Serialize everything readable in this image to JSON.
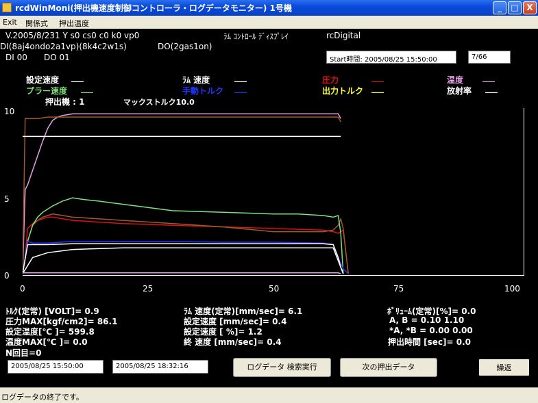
{
  "window": {
    "title": "rcdWinMoni(押出機速度制御コントローラ・ログデータモニター) 1号機",
    "min_label": "_",
    "max_label": "□",
    "close_label": "X"
  },
  "menu": [
    "Exit",
    "関係式",
    "押出温度"
  ],
  "header": {
    "version": "V.2005/8/231 Y s0 cs0 c0 k0 vp0",
    "display_title": "ﾗﾑ ｺﾝﾄﾛｰﾙ ﾃﾞｨｽﾌﾟﾚｲ",
    "brand": "rcDigital",
    "di_line": "DI(8aj4ondo2a1vp)(8k4c2w1s)",
    "do_line": "DO(2gas1on)",
    "di_value": "DI 00",
    "do_value": "DO 01",
    "start_time": "Start時間:    2005/08/25 15:50:00",
    "counter": "7/66"
  },
  "legend": {
    "set_speed": "設定速度",
    "ram_speed": "ﾗﾑ 速度",
    "pressure": "圧力",
    "temperature": "温度",
    "puller_speed": "プラー速度",
    "manual_torque": "手動トルク",
    "output_torque": "出力トルク",
    "radiation": "放射率",
    "extruder": "押出機 : 1",
    "max_torque": "マックストルク10.0",
    "placeholder": "___"
  },
  "colors": {
    "set_speed": "#ffffff",
    "ram_speed": "#ffffff",
    "pressure": "#dd1111",
    "temperature": "#e6a0e6",
    "puller_speed": "#80e080",
    "manual_torque": "#2233ff",
    "output_torque": "#ffff33",
    "radiation": "#ffffff",
    "brown": "#a05a28"
  },
  "chart_data": {
    "type": "line",
    "x_ticks": [
      "0",
      "25",
      "50",
      "75",
      "100"
    ],
    "y_ticks": [
      "0",
      "5",
      "10"
    ],
    "xlim": [
      0,
      100
    ],
    "ylim": [
      0,
      10
    ],
    "grid": false,
    "series": [
      {
        "color": "#e6a0e6",
        "x": [
          0,
          0.5,
          1,
          2,
          3,
          4,
          5,
          6,
          7,
          8,
          10,
          12,
          15,
          20,
          40,
          60,
          63,
          63.5
        ],
        "y": [
          0,
          5.2,
          5.5,
          6.4,
          7.3,
          8.2,
          9.0,
          9.5,
          9.7,
          9.8,
          9.9,
          9.9,
          9.9,
          9.9,
          9.9,
          9.9,
          9.9,
          9.6
        ]
      },
      {
        "color": "#a05a28",
        "x": [
          0,
          0.5,
          1,
          3,
          5,
          10,
          30,
          63,
          63.5
        ],
        "y": [
          0,
          9.6,
          9.6,
          9.6,
          9.7,
          9.7,
          9.7,
          9.7,
          9.4
        ]
      },
      {
        "color": "#ffffff",
        "x": [
          0,
          8,
          63.5
        ],
        "y": [
          8.5,
          8.5,
          8.5
        ]
      },
      {
        "color": "#dd1111",
        "x": [
          0,
          0.5,
          1,
          2,
          3,
          4,
          5,
          6,
          8,
          10,
          15,
          20,
          30,
          40,
          50,
          55,
          60,
          62,
          63,
          64,
          65
        ],
        "y": [
          0,
          1.0,
          2.8,
          3.1,
          3.3,
          3.4,
          3.5,
          3.5,
          3.4,
          3.3,
          3.2,
          3.1,
          3.0,
          2.9,
          2.8,
          2.75,
          2.7,
          2.6,
          2.5,
          2.7,
          0
        ]
      },
      {
        "color": "#a05a28",
        "x": [
          0,
          1,
          2,
          3,
          4,
          5,
          6,
          8,
          10,
          20,
          30,
          40,
          50,
          60,
          62,
          63,
          63.5,
          64,
          65
        ],
        "y": [
          0,
          2.0,
          3.0,
          3.3,
          3.5,
          3.6,
          3.7,
          3.6,
          3.5,
          3.3,
          3.1,
          2.9,
          2.6,
          2.6,
          2.7,
          3.0,
          3.4,
          2.8,
          0
        ]
      },
      {
        "color": "#80e080",
        "x": [
          0,
          1,
          2,
          3,
          4,
          5,
          6,
          8,
          10,
          12,
          15,
          20,
          25,
          30,
          40,
          50,
          55,
          60,
          62,
          63,
          63.5,
          64
        ],
        "y": [
          0,
          2.0,
          3.0,
          3.5,
          3.8,
          4.0,
          4.2,
          4.5,
          4.7,
          4.6,
          4.5,
          4.3,
          4.1,
          3.9,
          3.8,
          3.7,
          3.7,
          3.6,
          3.5,
          3.6,
          2.5,
          0
        ]
      },
      {
        "color": "#2233ff",
        "x": [
          0,
          1,
          2,
          5,
          10,
          20,
          30,
          40,
          50,
          60,
          62,
          63,
          64,
          65
        ],
        "y": [
          0,
          2.0,
          1.9,
          1.9,
          2.0,
          2.0,
          2.0,
          1.95,
          1.95,
          1.9,
          1.8,
          1.0,
          0.3,
          0
        ]
      },
      {
        "color": "#ffffff",
        "x": [
          0,
          1,
          2,
          5,
          10,
          20,
          30,
          40,
          50,
          60,
          62,
          63,
          63.5,
          64
        ],
        "y": [
          0,
          1.8,
          1.8,
          1.8,
          1.85,
          1.85,
          1.85,
          1.85,
          1.85,
          1.85,
          1.8,
          1.0,
          0.4,
          0
        ]
      },
      {
        "color": "#ffffff",
        "x": [
          0,
          1,
          2,
          5,
          10,
          20,
          30,
          40,
          50,
          60,
          62,
          63,
          64
        ],
        "y": [
          0,
          0.5,
          1.0,
          1.3,
          1.5,
          1.6,
          1.6,
          1.6,
          1.6,
          1.6,
          1.6,
          0.8,
          0
        ]
      },
      {
        "color": "#e6a0e6",
        "x": [
          0,
          63,
          63.5
        ],
        "y": [
          0.05,
          0.05,
          0
        ]
      }
    ]
  },
  "stats": {
    "torque": "ﾄﾙｸ(定常)  [VOLT]= 0.9",
    "pressure_max": "圧力MAX[kgf/cm2]= 86.1",
    "set_temp": "設定温度[℃     ]= 599.8",
    "temp_max": "温度MAX[℃     ]= 0.0",
    "n_count": "N回目=0",
    "ram_speed_steady": "ﾗﾑ 速度(定常)[mm/sec]= 6.1",
    "set_speed_1": "設定速度        [mm/sec]= 0.4",
    "set_speed_2": "設定速度              [ %]= 1.2",
    "end_speed": "終  速度        [mm/sec]= 0.4",
    "volume": "ﾎﾞﾘｭｰﾑ(定常)[%]= 0.0",
    "ab": "A, B              = 0.10 1.10",
    "ab_star": "*A, *B            = 0.00 0.00",
    "extrude_time": "押出時間   [sec]= 0.0"
  },
  "controls": {
    "date_from": "2005/08/25 15:50:00",
    "date_to": "2005/08/25 18:32:16",
    "search_button": "ログデータ  検索実行",
    "next_button": "次の押出データ",
    "repeat_button": "繰返"
  },
  "status": "ログデータの終了です。"
}
